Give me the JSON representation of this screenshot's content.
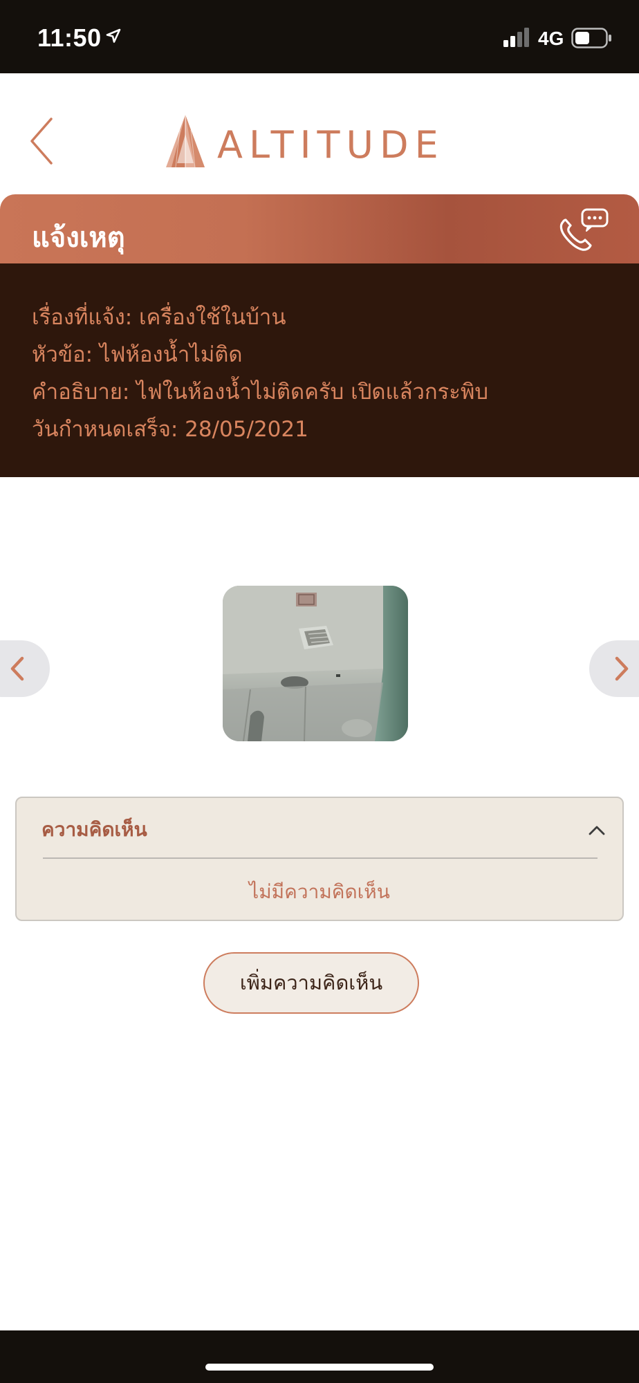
{
  "status_bar": {
    "time": "11:50",
    "network": "4G"
  },
  "header": {
    "brand_name": "ALTITUDE",
    "icons": [
      "chevron-left-icon",
      "altitude-logo-icon"
    ]
  },
  "report": {
    "title": "แจ้งเหตุ",
    "details": [
      "เรื่องที่แจ้ง: เครื่องใช้ในบ้าน",
      "หัวข้อ: ไฟห้องน้ำไม่ติด",
      "คำอธิบาย: ไฟในห้องน้ำไม่ติดครับ เปิดแล้วกระพิบ",
      "วันกำหนดเสร็จ: 28/05/2021"
    ]
  },
  "comments": {
    "header": "ความคิดเห็น",
    "empty_text": "ไม่มีความคิดเห็น",
    "add_button": "เพิ่มความคิดเห็น"
  },
  "colors": {
    "accent": "#cd7c5d",
    "panel_dark": "#2e170c",
    "card_bg": "#efe9e0",
    "status_bar": "#14100c"
  }
}
